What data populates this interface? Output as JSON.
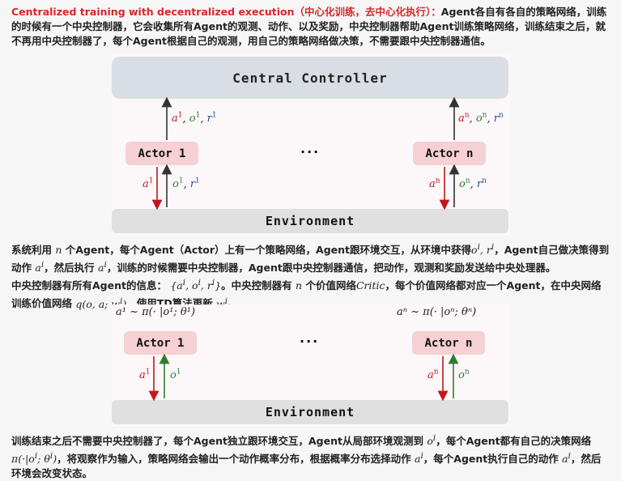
{
  "intro": {
    "heading": "Centralized training with decentralized execution（中心化训练，去中心化执行）：",
    "text": "Agent各自有各自的策略网络，训练的时候有一个中央控制器，它会收集所有Agent的观测、动作、以及奖励，中央控制器帮助Agent训练策略网络，训练结束之后，就不再用中央控制器了，每个Agent根据自己的观测，用自己的策略网络做决策，不需要跟中央控制器通信。"
  },
  "diagram1": {
    "controller_label": "Central Controller",
    "environment_label": "Environment",
    "actor1_label": "Actor 1",
    "actorn_label": "Actor n",
    "ellipsis": "···"
  },
  "para2": {
    "line1_a": "系统利用",
    "n": "n",
    "line1_b": "个Agent，每个Agent（Actor）上有一个策略网络，Agent跟环境交互，从环境中获得",
    "line1_c": "，Agent自己做决策得到动作",
    "line1_d": "，然后执行",
    "line1_e": "，训练的时候需要中央控制器，Agent跟中央控制器通信，把动作，观测和奖励发送给中央处理器。",
    "line2_a": "中央控制器有所有Agent的信息：",
    "line2_b": "。中央控制器有",
    "line2_c": "个价值网络",
    "critic": "Critic",
    "line2_d": "，每个价值网络都对应一个Agent，在中央网络训练价值网络",
    "line2_e": "，使用TD算法更新",
    "line2_f": "。"
  },
  "diagram2": {
    "environment_label": "Environment",
    "actor1_label": "Actor 1",
    "actorn_label": "Actor n",
    "ellipsis": "···",
    "policy1": "a¹ ~ π(· |o¹; θ¹)",
    "policyn": "aⁿ ~ π(· |oⁿ; θⁿ)"
  },
  "para3": {
    "a": "训练结束之后不需要中央控制器了，每个Agent独立跟环境交互，Agent从局部环境观测到",
    "b": "，每个Agent都有自己的决策网络",
    "c": "，将观察作为输入，策略网络会输出一个动作概率分布，根据概率分布选择动作",
    "d": "，每个Agent执行自己的动作",
    "e": "，然后环境会改变状态。"
  },
  "colors": {
    "red": "#c21818",
    "green": "#2e7d32",
    "blue": "#2b4c9e",
    "actor": "#f6d0d2",
    "controller": "#d9dde4"
  }
}
